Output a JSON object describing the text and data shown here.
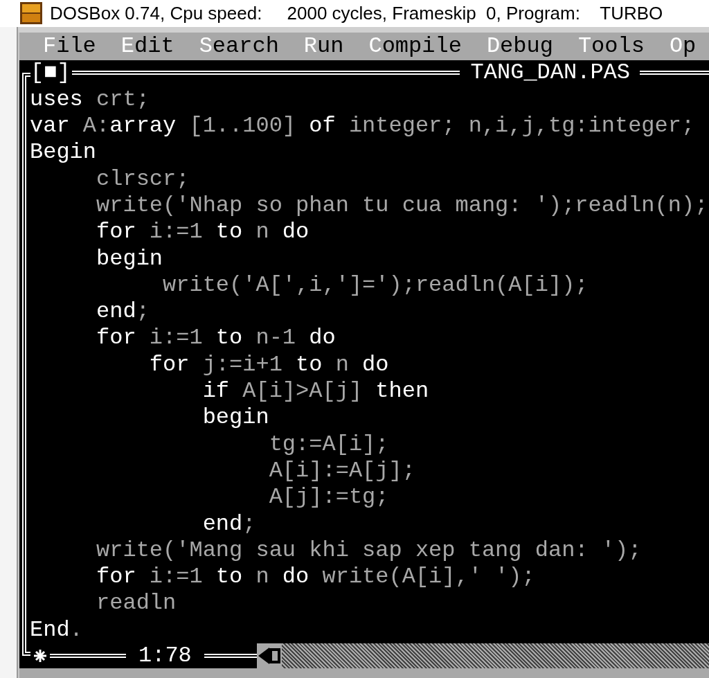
{
  "window": {
    "title": "DOSBox 0.74, Cpu speed:     2000 cycles, Frameskip  0, Program:    TURBO"
  },
  "menu": {
    "items": [
      {
        "label": "File"
      },
      {
        "label": "Edit"
      },
      {
        "label": "Search"
      },
      {
        "label": "Run"
      },
      {
        "label": "Compile"
      },
      {
        "label": "Debug"
      },
      {
        "label": "Tools"
      },
      {
        "label": "Op"
      }
    ]
  },
  "editor": {
    "close_box": "[■]",
    "filename": "TANG_DAN.PAS",
    "position": "1:78",
    "lines": [
      {
        "segments": [
          {
            "text": "uses",
            "kind": "keyword"
          },
          {
            "text": " crt;",
            "kind": "plain"
          }
        ]
      },
      {
        "segments": [
          {
            "text": "var",
            "kind": "keyword"
          },
          {
            "text": " A:",
            "kind": "plain"
          },
          {
            "text": "array",
            "kind": "keyword"
          },
          {
            "text": " [1..100] ",
            "kind": "plain"
          },
          {
            "text": "of",
            "kind": "keyword"
          },
          {
            "text": " integer; n,i,j,tg:integer;",
            "kind": "plain"
          }
        ]
      },
      {
        "segments": [
          {
            "text": "Begin",
            "kind": "keyword"
          }
        ]
      },
      {
        "segments": [
          {
            "text": "     clrscr;",
            "kind": "plain"
          }
        ]
      },
      {
        "segments": [
          {
            "text": "     write('Nhap so phan tu cua mang: ');readln(n);",
            "kind": "plain"
          }
        ]
      },
      {
        "segments": [
          {
            "text": "     for",
            "kind": "keyword"
          },
          {
            "text": " i:=1 ",
            "kind": "plain"
          },
          {
            "text": "to",
            "kind": "keyword"
          },
          {
            "text": " n ",
            "kind": "plain"
          },
          {
            "text": "do",
            "kind": "keyword"
          }
        ]
      },
      {
        "segments": [
          {
            "text": "     begin",
            "kind": "keyword"
          }
        ]
      },
      {
        "segments": [
          {
            "text": "          write('A[',i,']=');readln(A[i]);",
            "kind": "plain"
          }
        ]
      },
      {
        "segments": [
          {
            "text": "     end",
            "kind": "keyword"
          },
          {
            "text": ";",
            "kind": "plain"
          }
        ]
      },
      {
        "segments": [
          {
            "text": "     for",
            "kind": "keyword"
          },
          {
            "text": " i:=1 ",
            "kind": "plain"
          },
          {
            "text": "to",
            "kind": "keyword"
          },
          {
            "text": " n-1 ",
            "kind": "plain"
          },
          {
            "text": "do",
            "kind": "keyword"
          }
        ]
      },
      {
        "segments": [
          {
            "text": "         for",
            "kind": "keyword"
          },
          {
            "text": " j:=i+1 ",
            "kind": "plain"
          },
          {
            "text": "to",
            "kind": "keyword"
          },
          {
            "text": " n ",
            "kind": "plain"
          },
          {
            "text": "do",
            "kind": "keyword"
          }
        ]
      },
      {
        "segments": [
          {
            "text": "             if",
            "kind": "keyword"
          },
          {
            "text": " A[i]>A[j] ",
            "kind": "plain"
          },
          {
            "text": "then",
            "kind": "keyword"
          }
        ]
      },
      {
        "segments": [
          {
            "text": "             begin",
            "kind": "keyword"
          }
        ]
      },
      {
        "segments": [
          {
            "text": "                  tg:=A[i];",
            "kind": "plain"
          }
        ]
      },
      {
        "segments": [
          {
            "text": "                  A[i]:=A[j];",
            "kind": "plain"
          }
        ]
      },
      {
        "segments": [
          {
            "text": "                  A[j]:=tg;",
            "kind": "plain"
          }
        ]
      },
      {
        "segments": [
          {
            "text": "             end",
            "kind": "keyword"
          },
          {
            "text": ";",
            "kind": "plain"
          }
        ]
      },
      {
        "segments": [
          {
            "text": "     write('Mang sau khi sap xep tang dan: ');",
            "kind": "plain"
          }
        ]
      },
      {
        "segments": [
          {
            "text": "     for",
            "kind": "keyword"
          },
          {
            "text": " i:=1 ",
            "kind": "plain"
          },
          {
            "text": "to",
            "kind": "keyword"
          },
          {
            "text": " n ",
            "kind": "plain"
          },
          {
            "text": "do",
            "kind": "keyword"
          },
          {
            "text": " write(A[i],' ');",
            "kind": "plain"
          }
        ]
      },
      {
        "segments": [
          {
            "text": "     readln",
            "kind": "plain"
          }
        ]
      },
      {
        "segments": [
          {
            "text": "End",
            "kind": "keyword"
          },
          {
            "text": ".",
            "kind": "plain"
          }
        ]
      }
    ]
  }
}
